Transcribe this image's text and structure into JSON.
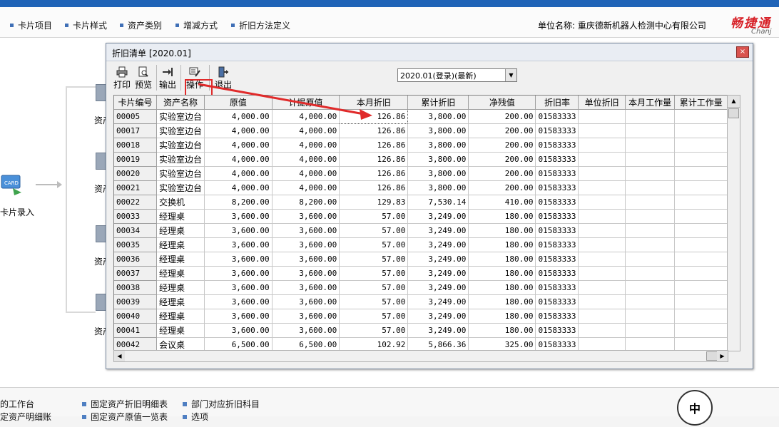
{
  "menubar": {
    "items": [
      "卡片项目",
      "卡片样式",
      "资产类别",
      "增减方式",
      "折旧方法定义"
    ],
    "company": "单位名称: 重庆德新机器人检测中心有限公司",
    "logo": "畅捷通",
    "logo_sub": "Chanj"
  },
  "background": {
    "card_entry_label": "卡片录入",
    "asset_labels": [
      "资产",
      "资产",
      "资产",
      "资产"
    ]
  },
  "dialog": {
    "title": "折旧清单 [2020.01]",
    "close": "×",
    "toolbar": {
      "print": "打印",
      "preview": "预览",
      "export": "输出",
      "operate": "操作",
      "exit": "退出"
    },
    "period": "2020.01(登录)(最新)",
    "columns": [
      "卡片编号",
      "资产名称",
      "原值",
      "计提原值",
      "本月折旧",
      "累计折旧",
      "净残值",
      "折旧率",
      "单位折旧",
      "本月工作量",
      "累计工作量"
    ],
    "rows": [
      [
        "00005",
        "实验室边台",
        "4,000.00",
        "4,000.00",
        "126.86",
        "3,800.00",
        "200.00",
        "01583333"
      ],
      [
        "00017",
        "实验室边台",
        "4,000.00",
        "4,000.00",
        "126.86",
        "3,800.00",
        "200.00",
        "01583333"
      ],
      [
        "00018",
        "实验室边台",
        "4,000.00",
        "4,000.00",
        "126.86",
        "3,800.00",
        "200.00",
        "01583333"
      ],
      [
        "00019",
        "实验室边台",
        "4,000.00",
        "4,000.00",
        "126.86",
        "3,800.00",
        "200.00",
        "01583333"
      ],
      [
        "00020",
        "实验室边台",
        "4,000.00",
        "4,000.00",
        "126.86",
        "3,800.00",
        "200.00",
        "01583333"
      ],
      [
        "00021",
        "实验室边台",
        "4,000.00",
        "4,000.00",
        "126.86",
        "3,800.00",
        "200.00",
        "01583333"
      ],
      [
        "00022",
        "交换机",
        "8,200.00",
        "8,200.00",
        "129.83",
        "7,530.14",
        "410.00",
        "01583333"
      ],
      [
        "00033",
        "经理桌",
        "3,600.00",
        "3,600.00",
        "57.00",
        "3,249.00",
        "180.00",
        "01583333"
      ],
      [
        "00034",
        "经理桌",
        "3,600.00",
        "3,600.00",
        "57.00",
        "3,249.00",
        "180.00",
        "01583333"
      ],
      [
        "00035",
        "经理桌",
        "3,600.00",
        "3,600.00",
        "57.00",
        "3,249.00",
        "180.00",
        "01583333"
      ],
      [
        "00036",
        "经理桌",
        "3,600.00",
        "3,600.00",
        "57.00",
        "3,249.00",
        "180.00",
        "01583333"
      ],
      [
        "00037",
        "经理桌",
        "3,600.00",
        "3,600.00",
        "57.00",
        "3,249.00",
        "180.00",
        "01583333"
      ],
      [
        "00038",
        "经理桌",
        "3,600.00",
        "3,600.00",
        "57.00",
        "3,249.00",
        "180.00",
        "01583333"
      ],
      [
        "00039",
        "经理桌",
        "3,600.00",
        "3,600.00",
        "57.00",
        "3,249.00",
        "180.00",
        "01583333"
      ],
      [
        "00040",
        "经理桌",
        "3,600.00",
        "3,600.00",
        "57.00",
        "3,249.00",
        "180.00",
        "01583333"
      ],
      [
        "00041",
        "经理桌",
        "3,600.00",
        "3,600.00",
        "57.00",
        "3,249.00",
        "180.00",
        "01583333"
      ],
      [
        "00042",
        "会议桌",
        "6,500.00",
        "6,500.00",
        "102.92",
        "5,866.36",
        "325.00",
        "01583333"
      ]
    ]
  },
  "bottom": {
    "links": [
      "的工作台",
      "固定资产折旧明细表",
      "部门对应折旧科目",
      "定资产明细账",
      "固定资产原值一览表",
      "选项"
    ],
    "ime": "中"
  },
  "colors": {
    "accent": "#1f63b7",
    "highlight": "#e02a2a",
    "logo": "#d71f26"
  }
}
